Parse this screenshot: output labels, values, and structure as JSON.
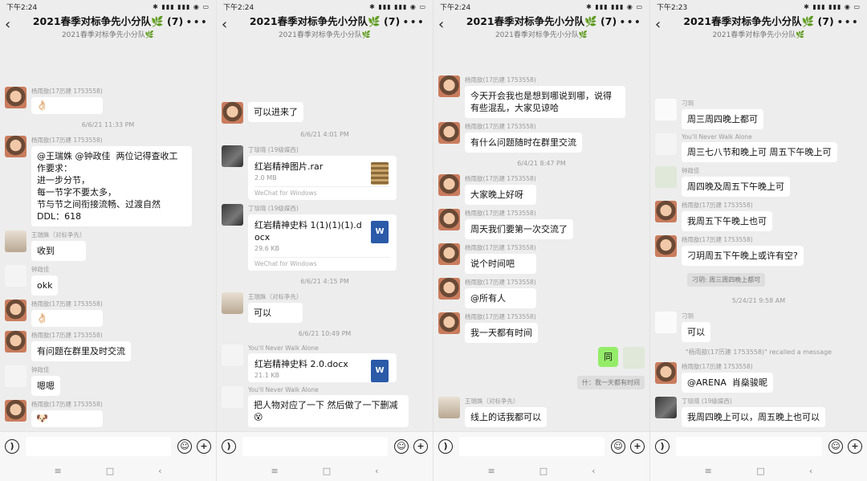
{
  "panels": [
    {
      "time": "下午2:24",
      "title": "2021春季对标争先小分队🌿 (7)",
      "subtitle": "2021春季对标争先小分队🌿",
      "messages": [
        {
          "kind": "msg",
          "sender": "杨雨歆(17历建 1753558)",
          "text": "👌🏻",
          "avatar": "child"
        },
        {
          "kind": "time",
          "text": "6/6/21 11:33 PM"
        },
        {
          "kind": "msg",
          "sender": "杨雨歆(17历建 1753558)",
          "text": "@王瑞姝 @钟政佳  两位记得查收工作要求：\n进一步分节，\n每一节字不要太多，\n节与节之间衔接流畅、过渡自然\nDDL：618",
          "avatar": "child"
        },
        {
          "kind": "msg",
          "sender": "王瑞姝（对标争先）",
          "text": "收到",
          "avatar": "girl"
        },
        {
          "kind": "msg",
          "sender": "钟政佳",
          "text": "okk",
          "avatar": "ink"
        },
        {
          "kind": "msg",
          "sender": "杨雨歆(17历建 1753558)",
          "text": "👌🏻",
          "avatar": "child"
        },
        {
          "kind": "msg",
          "sender": "杨雨歆(17历建 1753558)",
          "text": "有问题在群里及时交流",
          "avatar": "child"
        },
        {
          "kind": "msg",
          "sender": "钟政佳",
          "text": "嗯嗯",
          "avatar": "ink"
        },
        {
          "kind": "msg",
          "sender": "杨雨歆(17历建 1753558)",
          "text": "🐶",
          "avatar": "child"
        }
      ]
    },
    {
      "time": "下午2:24",
      "title": "2021春季对标争先小分队🌿 (7)",
      "subtitle": "2021春季对标争先小分队🌿",
      "messages": [
        {
          "kind": "msg",
          "sender": "",
          "text": "可以进来了",
          "avatar": "child"
        },
        {
          "kind": "time",
          "text": "6/6/21 4:01 PM"
        },
        {
          "kind": "file",
          "sender": "丁琰晓 (19级媒西)",
          "name": "红岩精神图片.rar",
          "size": "2.0 MB",
          "source": "WeChat for Windows",
          "icon": "rar",
          "avatar": "dark"
        },
        {
          "kind": "file",
          "sender": "丁琰晓 (19级媒西)",
          "name": "红岩精神史料 1(1)(1)(1).docx",
          "size": "29.6 KB",
          "source": "WeChat for Windows",
          "icon": "doc",
          "avatar": "dark"
        },
        {
          "kind": "time",
          "text": "6/6/21 4:15 PM"
        },
        {
          "kind": "msg",
          "sender": "王瑞姝（对标争先）",
          "text": "可以",
          "avatar": "girl"
        },
        {
          "kind": "time",
          "text": "6/6/21 10:49 PM"
        },
        {
          "kind": "file",
          "sender": "You'll Never Walk Alone",
          "name": "红岩精神史料 2.0.docx",
          "size": "21.1 KB",
          "source": "",
          "icon": "doc",
          "avatar": "ink"
        },
        {
          "kind": "msg",
          "sender": "You'll Never Walk Alone",
          "text": "把人物对应了一下 然后做了一下删减😵",
          "avatar": "ink"
        }
      ]
    },
    {
      "time": "下午2:24",
      "title": "2021春季对标争先小分队🌿 (7)",
      "subtitle": "2021春季对标争先小分队🌿",
      "messages": [
        {
          "kind": "msg",
          "sender": "杨雨歆(17历建 1753558)",
          "text": "今天开会我也是想到哪说到哪，说得有些混乱，大家见谅哈",
          "avatar": "child"
        },
        {
          "kind": "msg",
          "sender": "杨雨歆(17历建 1753558)",
          "text": "有什么问题随时在群里交流",
          "avatar": "child"
        },
        {
          "kind": "time",
          "text": "6/4/21 8:47 PM"
        },
        {
          "kind": "msg",
          "sender": "杨雨歆(17历建 1753558)",
          "text": "大家晚上好呀",
          "avatar": "child"
        },
        {
          "kind": "msg",
          "sender": "杨雨歆(17历建 1753558)",
          "text": "周天我们要第一次交流了",
          "avatar": "child"
        },
        {
          "kind": "msg",
          "sender": "杨雨歆(17历建 1753558)",
          "text": "说个时间吧",
          "avatar": "child"
        },
        {
          "kind": "msg",
          "sender": "杨雨歆(17历建 1753558)",
          "text": "@所有人",
          "avatar": "child"
        },
        {
          "kind": "msg",
          "sender": "杨雨歆(17历建 1753558)",
          "text": "我一天都有时间",
          "avatar": "child"
        },
        {
          "kind": "self",
          "text": "同"
        },
        {
          "kind": "quote",
          "text": "什：我一天都有时间"
        },
        {
          "kind": "msg",
          "sender": "王瑞姝（对标争先）",
          "text": "线上的话我都可以",
          "avatar": "girl"
        }
      ]
    },
    {
      "time": "下午2:23",
      "title": "2021春季对标争先小分队🌿 (7)",
      "subtitle": "2021春季对标争先小分队🌿",
      "messages": [
        {
          "kind": "msg",
          "sender": "刁玥",
          "text": "周三周四晚上都可",
          "avatar": "lily"
        },
        {
          "kind": "msg",
          "sender": "You'll Never Walk Alone",
          "text": "周三七八节和晚上可 周五下午晚上可",
          "avatar": "ink"
        },
        {
          "kind": "msg",
          "sender": "钟政佳",
          "text": "周四晚及周五下午晚上可",
          "avatar": "cartoon"
        },
        {
          "kind": "msg",
          "sender": "杨雨歆(17历建 1753558)",
          "text": "我周五下午晚上也可",
          "avatar": "child"
        },
        {
          "kind": "msg",
          "sender": "杨雨歆(17历建 1753558)",
          "text": "刁玥周五下午晚上或许有空?",
          "avatar": "child"
        },
        {
          "kind": "quote",
          "text": "刁玥: 周三周四晚上都可"
        },
        {
          "kind": "time",
          "text": "5/24/21 9:58 AM"
        },
        {
          "kind": "msg",
          "sender": "刁玥",
          "text": "可以",
          "avatar": "lily"
        },
        {
          "kind": "sys",
          "text": "\"杨雨歆(17历建 1753558)\" recalled a message"
        },
        {
          "kind": "msg",
          "sender": "杨雨歆(17历建 1753558)",
          "text": "@ARENA  肖燊骏昵",
          "avatar": "child"
        },
        {
          "kind": "msg",
          "sender": "丁琰晓 (19级媒西)",
          "text": "我周四晚上可以，周五晚上也可以",
          "avatar": "dark"
        }
      ]
    }
  ]
}
